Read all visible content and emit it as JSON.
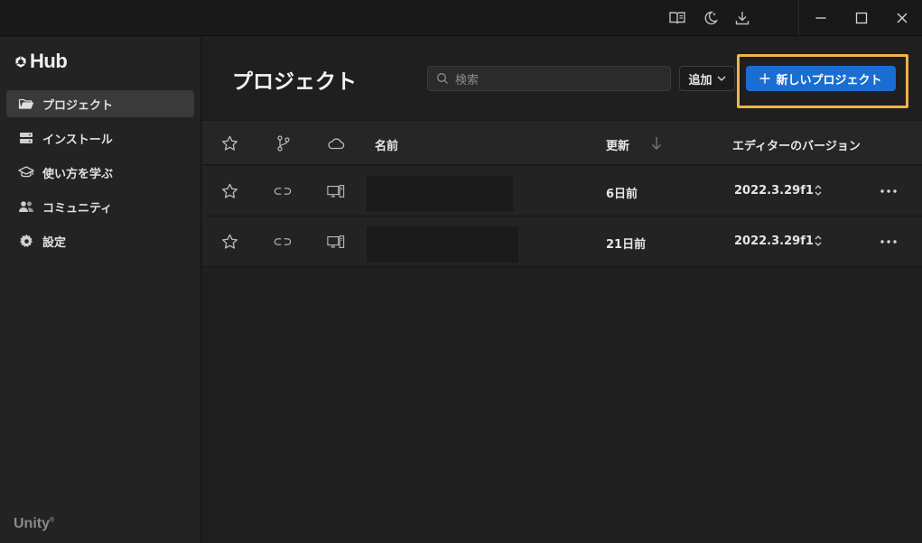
{
  "sidebar": {
    "logo_text": "Hub",
    "items": [
      {
        "label": "プロジェクト",
        "icon": "folder-icon",
        "active": true
      },
      {
        "label": "インストール",
        "icon": "server-icon",
        "active": false
      },
      {
        "label": "使い方を学ぶ",
        "icon": "graduation-cap-icon",
        "active": false
      },
      {
        "label": "コミュニティ",
        "icon": "people-icon",
        "active": false
      },
      {
        "label": "設定",
        "icon": "gear-icon",
        "active": false
      }
    ],
    "brand": "Unity"
  },
  "titlebar": {
    "icons": [
      "book-icon",
      "moon-icon",
      "download-icon"
    ],
    "window_controls": [
      "minimize-icon",
      "maximize-icon",
      "close-icon"
    ]
  },
  "main": {
    "title": "プロジェクト",
    "search_placeholder": "検索",
    "add_label": "追加",
    "new_project_label": "新しいプロジェクト",
    "accent_color": "#1b6ed1",
    "highlight_color": "#f0b34a"
  },
  "table": {
    "columns": {
      "name": "名前",
      "updated": "更新",
      "editor_version": "エディターのバージョン"
    },
    "rows": [
      {
        "updated": "6日前",
        "version": "2022.3.29f1"
      },
      {
        "updated": "21日前",
        "version": "2022.3.29f1"
      }
    ]
  }
}
